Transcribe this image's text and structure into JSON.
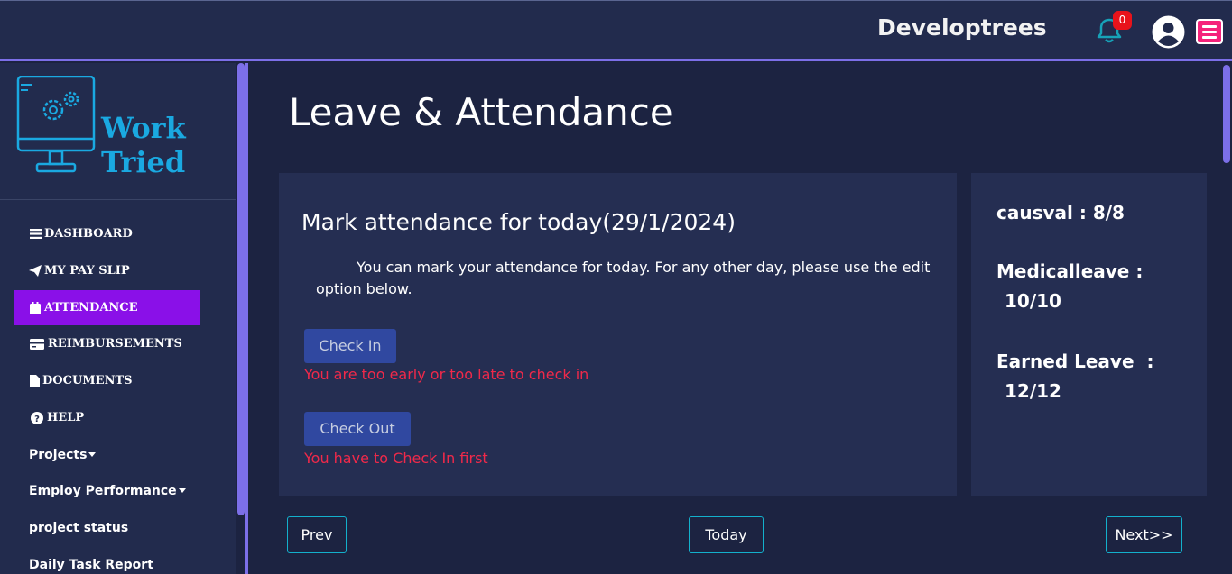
{
  "header": {
    "company": "Developtrees",
    "notification_count": "0",
    "icons": {
      "bell": "bell-icon",
      "user": "user-avatar-icon",
      "menu": "hamburger-menu-icon"
    },
    "colors": {
      "bell": "#17a2b8",
      "badge": "#e8131b",
      "menu": "#f5227b"
    }
  },
  "sidebar": {
    "logo_text": "Work Tried",
    "items": [
      {
        "label": "DASHBOARD",
        "icon": "bars-icon"
      },
      {
        "label": "MY PAY SLIP",
        "icon": "paper-plane-icon"
      },
      {
        "label": "ATTENDANCE",
        "icon": "calendar-icon",
        "active": true
      },
      {
        "label": "REIMBURSEMENTS",
        "icon": "credit-card-icon"
      },
      {
        "label": "DOCUMENTS",
        "icon": "file-icon"
      },
      {
        "label": "HELP",
        "icon": "question-circle-icon"
      },
      {
        "label": "Projects",
        "icon": "caret-down-icon"
      },
      {
        "label": "Employ Performance",
        "icon": "caret-down-icon"
      },
      {
        "label": "project status"
      },
      {
        "label": "Daily Task Report"
      }
    ],
    "active_color": "#8a10e8"
  },
  "main": {
    "title": "Leave & Attendance",
    "attendance": {
      "heading": "Mark attendance for today(29/1/2024)",
      "description": "You can mark your attendance for today. For any other day, please use the edit option below.",
      "check_in_label": "Check In",
      "check_in_error": "You are too early or too late to check in",
      "check_out_label": "Check Out",
      "check_out_error": "You have to Check In first"
    },
    "leaves": [
      {
        "name": "causval",
        "sep": " : ",
        "value": "8/8"
      },
      {
        "name": "Medicalleave",
        "sep": " : ",
        "value": "10/10"
      },
      {
        "name": "Earned Leave",
        "sep": "  : ",
        "value": "12/12"
      }
    ],
    "pager": {
      "prev": "Prev",
      "today": "Today",
      "next": "Next>>"
    }
  }
}
